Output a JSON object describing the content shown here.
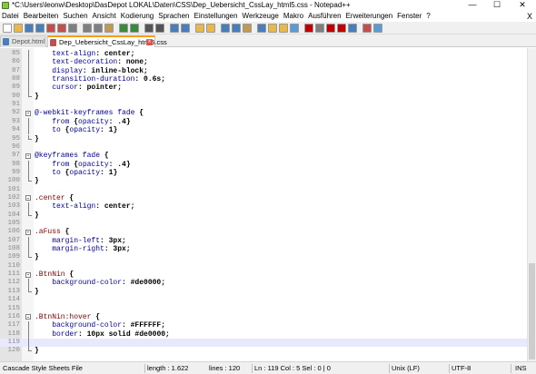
{
  "window": {
    "title": "*C:\\Users\\leonw\\Desktop\\DasDepot LOKAL\\Daten\\CSS\\Dep_Uebersicht_CssLay_html5.css - Notepad++",
    "minimize": "—",
    "maximize": "☐",
    "close": "✕"
  },
  "menu": {
    "items": [
      "Datei",
      "Bearbeiten",
      "Suchen",
      "Ansicht",
      "Kodierung",
      "Sprachen",
      "Einstellungen",
      "Werkzeuge",
      "Makro",
      "Ausführen",
      "Erweiterungen",
      "Fenster",
      "?"
    ],
    "close_x": "X"
  },
  "toolbar": {
    "buttons": [
      {
        "name": "new-file-icon",
        "color": "#ffffff"
      },
      {
        "name": "open-file-icon",
        "color": "#e8b84a"
      },
      {
        "name": "save-icon",
        "color": "#4a7ebb"
      },
      {
        "name": "save-all-icon",
        "color": "#4a7ebb"
      },
      {
        "name": "close-icon",
        "color": "#c0504d"
      },
      {
        "name": "close-all-icon",
        "color": "#c0504d"
      },
      {
        "name": "print-icon",
        "color": "#7f7f7f"
      },
      {
        "name": "cut-icon",
        "color": "#7f7f7f"
      },
      {
        "name": "copy-icon",
        "color": "#7f7f7f"
      },
      {
        "name": "paste-icon",
        "color": "#c09a52"
      },
      {
        "name": "undo-icon",
        "color": "#3b8a3b"
      },
      {
        "name": "redo-icon",
        "color": "#3b8a3b"
      },
      {
        "name": "find-icon",
        "color": "#555555"
      },
      {
        "name": "replace-icon",
        "color": "#555555"
      },
      {
        "name": "zoom-in-icon",
        "color": "#4a7ebb"
      },
      {
        "name": "zoom-out-icon",
        "color": "#4a7ebb"
      },
      {
        "name": "sync-v-icon",
        "color": "#e8b84a"
      },
      {
        "name": "sync-h-icon",
        "color": "#e8b84a"
      },
      {
        "name": "word-wrap-icon",
        "color": "#4a7ebb"
      },
      {
        "name": "show-all-chars-icon",
        "color": "#4a7ebb"
      },
      {
        "name": "indent-guide-icon",
        "color": "#c09a52"
      },
      {
        "name": "doc-map-icon",
        "color": "#4a7ebb"
      },
      {
        "name": "function-list-icon",
        "color": "#e8b84a"
      },
      {
        "name": "folder-workspace-icon",
        "color": "#e8b84a"
      },
      {
        "name": "monitor-icon",
        "color": "#5b9bd5"
      },
      {
        "name": "record-macro-icon",
        "color": "#c00000"
      },
      {
        "name": "stop-macro-icon",
        "color": "#7f7f7f"
      },
      {
        "name": "play-macro-icon",
        "color": "#c00000"
      },
      {
        "name": "play-multiple-icon",
        "color": "#c00000"
      },
      {
        "name": "save-macro-icon",
        "color": "#4a7ebb"
      },
      {
        "name": "spell-check-icon",
        "color": "#c0504d"
      },
      {
        "name": "plugin-icon",
        "color": "#5b9bd5"
      }
    ]
  },
  "tabs": [
    {
      "label": "Depot.html",
      "active": false,
      "icon_color": "#4a7ebb"
    },
    {
      "label": "Dep_Uebersicht_CssLay_html5.css",
      "active": true,
      "icon_color": "#c0504d"
    }
  ],
  "tab_close": "x",
  "editor": {
    "current_line": 119,
    "lines": [
      {
        "n": "85",
        "fold": "line",
        "tokens": [
          {
            "t": "    ",
            "c": ""
          },
          {
            "t": "text-align",
            "c": "c-prop"
          },
          {
            "t": ": ",
            "c": "c-punct"
          },
          {
            "t": "center",
            "c": "c-val"
          },
          {
            "t": ";",
            "c": "c-punct"
          }
        ]
      },
      {
        "n": "86",
        "fold": "line",
        "tokens": [
          {
            "t": "    ",
            "c": ""
          },
          {
            "t": "text-decoration",
            "c": "c-prop"
          },
          {
            "t": ": ",
            "c": "c-punct"
          },
          {
            "t": "none",
            "c": "c-val"
          },
          {
            "t": ";",
            "c": "c-punct"
          }
        ]
      },
      {
        "n": "87",
        "fold": "line",
        "tokens": [
          {
            "t": "    ",
            "c": ""
          },
          {
            "t": "display",
            "c": "c-prop"
          },
          {
            "t": ": ",
            "c": "c-punct"
          },
          {
            "t": "inline-block",
            "c": "c-val"
          },
          {
            "t": ";",
            "c": "c-punct"
          }
        ]
      },
      {
        "n": "88",
        "fold": "line",
        "tokens": [
          {
            "t": "    ",
            "c": ""
          },
          {
            "t": "transition-duration",
            "c": "c-prop"
          },
          {
            "t": ": ",
            "c": "c-punct"
          },
          {
            "t": "0.6s",
            "c": "c-val"
          },
          {
            "t": ";",
            "c": "c-punct"
          }
        ]
      },
      {
        "n": "89",
        "fold": "line",
        "tokens": [
          {
            "t": "    ",
            "c": ""
          },
          {
            "t": "cursor",
            "c": "c-prop"
          },
          {
            "t": ": ",
            "c": "c-punct"
          },
          {
            "t": "pointer",
            "c": "c-val"
          },
          {
            "t": ";",
            "c": "c-punct"
          }
        ]
      },
      {
        "n": "90",
        "fold": "end",
        "tokens": [
          {
            "t": "}",
            "c": "c-punct"
          }
        ]
      },
      {
        "n": "91",
        "fold": "",
        "tokens": []
      },
      {
        "n": "92",
        "fold": "start",
        "tokens": [
          {
            "t": "@-webkit-keyframes fade",
            "c": "c-prop"
          },
          {
            "t": " {",
            "c": "c-punct"
          }
        ]
      },
      {
        "n": "93",
        "fold": "line",
        "tokens": [
          {
            "t": "    ",
            "c": ""
          },
          {
            "t": "from",
            "c": "c-prop"
          },
          {
            "t": " {",
            "c": "c-punct"
          },
          {
            "t": "opacity",
            "c": "c-prop"
          },
          {
            "t": ": ",
            "c": "c-punct"
          },
          {
            "t": ".4",
            "c": "c-val"
          },
          {
            "t": "}",
            "c": "c-punct"
          }
        ]
      },
      {
        "n": "94",
        "fold": "line",
        "tokens": [
          {
            "t": "    ",
            "c": ""
          },
          {
            "t": "to",
            "c": "c-prop"
          },
          {
            "t": " {",
            "c": "c-punct"
          },
          {
            "t": "opacity",
            "c": "c-prop"
          },
          {
            "t": ": ",
            "c": "c-punct"
          },
          {
            "t": "1",
            "c": "c-val"
          },
          {
            "t": "}",
            "c": "c-punct"
          }
        ]
      },
      {
        "n": "95",
        "fold": "end",
        "tokens": [
          {
            "t": "}",
            "c": "c-punct"
          }
        ]
      },
      {
        "n": "96",
        "fold": "",
        "tokens": []
      },
      {
        "n": "97",
        "fold": "start",
        "tokens": [
          {
            "t": "@keyframes fade",
            "c": "c-prop"
          },
          {
            "t": " {",
            "c": "c-punct"
          }
        ]
      },
      {
        "n": "98",
        "fold": "line",
        "tokens": [
          {
            "t": "    ",
            "c": ""
          },
          {
            "t": "from",
            "c": "c-prop"
          },
          {
            "t": " {",
            "c": "c-punct"
          },
          {
            "t": "opacity",
            "c": "c-prop"
          },
          {
            "t": ": ",
            "c": "c-punct"
          },
          {
            "t": ".4",
            "c": "c-val"
          },
          {
            "t": "}",
            "c": "c-punct"
          }
        ]
      },
      {
        "n": "99",
        "fold": "line",
        "tokens": [
          {
            "t": "    ",
            "c": ""
          },
          {
            "t": "to",
            "c": "c-prop"
          },
          {
            "t": " {",
            "c": "c-punct"
          },
          {
            "t": "opacity",
            "c": "c-prop"
          },
          {
            "t": ": ",
            "c": "c-punct"
          },
          {
            "t": "1",
            "c": "c-val"
          },
          {
            "t": "}",
            "c": "c-punct"
          }
        ]
      },
      {
        "n": "100",
        "fold": "end",
        "tokens": [
          {
            "t": "}",
            "c": "c-punct"
          }
        ]
      },
      {
        "n": "101",
        "fold": "",
        "tokens": []
      },
      {
        "n": "102",
        "fold": "start",
        "tokens": [
          {
            "t": ".center",
            "c": "c-sel"
          },
          {
            "t": " {",
            "c": "c-punct"
          }
        ]
      },
      {
        "n": "103",
        "fold": "line",
        "tokens": [
          {
            "t": "    ",
            "c": ""
          },
          {
            "t": "text-align",
            "c": "c-prop"
          },
          {
            "t": ": ",
            "c": "c-punct"
          },
          {
            "t": "center",
            "c": "c-val"
          },
          {
            "t": ";",
            "c": "c-punct"
          }
        ]
      },
      {
        "n": "104",
        "fold": "end",
        "tokens": [
          {
            "t": "}",
            "c": "c-punct"
          }
        ]
      },
      {
        "n": "105",
        "fold": "",
        "tokens": []
      },
      {
        "n": "106",
        "fold": "start",
        "tokens": [
          {
            "t": ".aFuss",
            "c": "c-sel"
          },
          {
            "t": " {",
            "c": "c-punct"
          }
        ]
      },
      {
        "n": "107",
        "fold": "line",
        "tokens": [
          {
            "t": "    ",
            "c": ""
          },
          {
            "t": "margin-left",
            "c": "c-prop"
          },
          {
            "t": ": ",
            "c": "c-punct"
          },
          {
            "t": "3px",
            "c": "c-val"
          },
          {
            "t": ";",
            "c": "c-punct"
          }
        ]
      },
      {
        "n": "108",
        "fold": "line",
        "tokens": [
          {
            "t": "    ",
            "c": ""
          },
          {
            "t": "margin-right",
            "c": "c-prop"
          },
          {
            "t": ": ",
            "c": "c-punct"
          },
          {
            "t": "3px",
            "c": "c-val"
          },
          {
            "t": ";",
            "c": "c-punct"
          }
        ]
      },
      {
        "n": "109",
        "fold": "end",
        "tokens": [
          {
            "t": "}",
            "c": "c-punct"
          }
        ]
      },
      {
        "n": "110",
        "fold": "",
        "tokens": []
      },
      {
        "n": "111",
        "fold": "start",
        "tokens": [
          {
            "t": ".BtnNin",
            "c": "c-sel"
          },
          {
            "t": " {",
            "c": "c-punct"
          }
        ]
      },
      {
        "n": "112",
        "fold": "line",
        "tokens": [
          {
            "t": "    ",
            "c": ""
          },
          {
            "t": "background-color",
            "c": "c-prop"
          },
          {
            "t": ": ",
            "c": "c-punct"
          },
          {
            "t": "#de0000",
            "c": "c-val"
          },
          {
            "t": ";",
            "c": "c-punct"
          }
        ]
      },
      {
        "n": "113",
        "fold": "end",
        "tokens": [
          {
            "t": "}",
            "c": "c-punct"
          }
        ]
      },
      {
        "n": "114",
        "fold": "",
        "tokens": []
      },
      {
        "n": "115",
        "fold": "",
        "tokens": []
      },
      {
        "n": "116",
        "fold": "start",
        "tokens": [
          {
            "t": ".BtnNin:hover",
            "c": "c-sel"
          },
          {
            "t": " {",
            "c": "c-punct"
          }
        ]
      },
      {
        "n": "117",
        "fold": "line",
        "tokens": [
          {
            "t": "    ",
            "c": ""
          },
          {
            "t": "background-color",
            "c": "c-prop"
          },
          {
            "t": ": ",
            "c": "c-punct"
          },
          {
            "t": "#FFFFFF",
            "c": "c-val"
          },
          {
            "t": ";",
            "c": "c-punct"
          }
        ]
      },
      {
        "n": "118",
        "fold": "line",
        "tokens": [
          {
            "t": "    ",
            "c": ""
          },
          {
            "t": "border",
            "c": "c-prop"
          },
          {
            "t": ": ",
            "c": "c-punct"
          },
          {
            "t": "10px solid #de0000",
            "c": "c-val"
          },
          {
            "t": ";",
            "c": "c-punct"
          }
        ]
      },
      {
        "n": "119",
        "fold": "line",
        "tokens": []
      },
      {
        "n": "120",
        "fold": "end",
        "tokens": [
          {
            "t": "}",
            "c": "c-punct"
          }
        ]
      }
    ]
  },
  "status": {
    "file_type": "Cascade Style Sheets File",
    "length": "length : 1.622",
    "lines": "lines : 120",
    "position": "Ln : 119   Col : 5   Sel : 0 | 0",
    "eol": "Unix (LF)",
    "encoding": "UTF-8",
    "mode": "INS"
  }
}
